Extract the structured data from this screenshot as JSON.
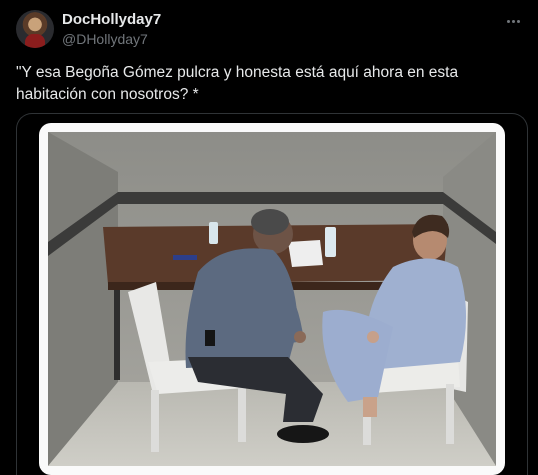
{
  "post": {
    "author": {
      "display_name": "DocHollyday7",
      "handle": "@DHollyday7"
    },
    "menu_icon": "more-horizontal-icon",
    "text": "\"Y esa Begoña Gómez pulcra y honesta está aquí ahora en esta habitación con nosotros? *",
    "media": {
      "kind": "photo"
    }
  },
  "colors": {
    "background": "#000000",
    "text_primary": "#e7e9ea",
    "text_secondary": "#71767b",
    "border": "#2f3336"
  }
}
